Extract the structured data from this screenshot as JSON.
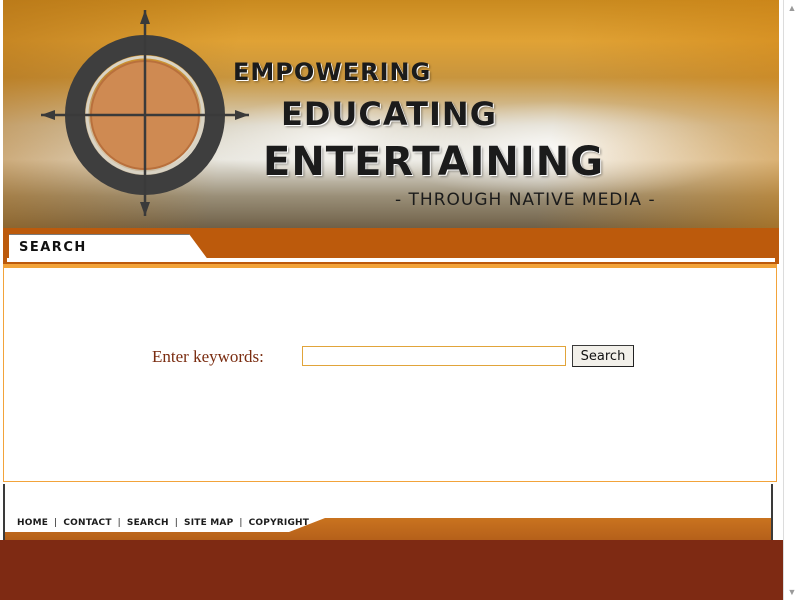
{
  "banner": {
    "line1": "EMPOWERING",
    "line2": "EDUCATING",
    "line3": "ENTERTAINING",
    "tagline": "- THROUGH NATIVE MEDIA -"
  },
  "tabbar": {
    "tab_label": "SEARCH"
  },
  "search": {
    "label": "Enter keywords:",
    "input_value": "",
    "button_label": "Search"
  },
  "footer": {
    "links": [
      "HOME",
      "CONTACT",
      "SEARCH",
      "SITE MAP",
      "COPYRIGHT"
    ],
    "separators": [
      "|",
      "|",
      "|",
      "|"
    ]
  },
  "colors": {
    "accent_orange": "#bc5a0c",
    "page_background": "#7e2a13",
    "label_brown": "#7a2c10",
    "input_border": "#e1a43a"
  },
  "icons": {
    "logo": "crosshair-target-icon",
    "scroll_up": "scroll-up-arrow-icon",
    "scroll_down": "scroll-down-arrow-icon"
  }
}
